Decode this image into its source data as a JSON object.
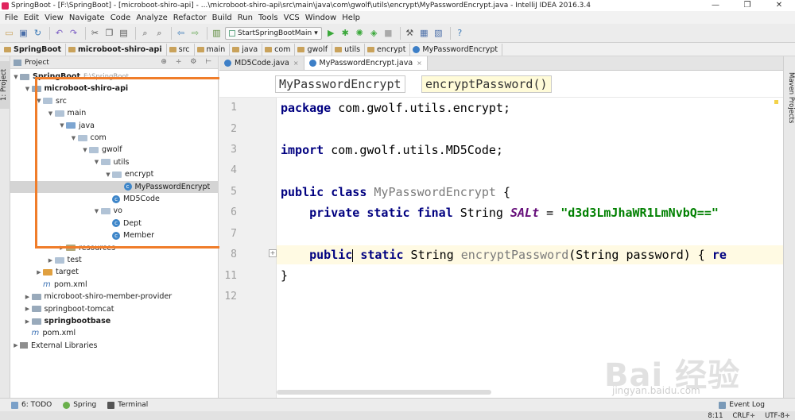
{
  "window": {
    "title": "SpringBoot - [F:\\SpringBoot] - [microboot-shiro-api] - ...\\microboot-shiro-api\\src\\main\\java\\com\\gwolf\\utils\\encrypt\\MyPasswordEncrypt.java - IntelliJ IDEA 2016.3.4",
    "controls": [
      "—",
      "❐",
      "✕"
    ]
  },
  "menu": [
    "File",
    "Edit",
    "View",
    "Navigate",
    "Code",
    "Analyze",
    "Refactor",
    "Build",
    "Run",
    "Tools",
    "VCS",
    "Window",
    "Help"
  ],
  "toolbar": {
    "run_config": "StartSpringBootMain",
    "run_config_arrow": "▾"
  },
  "breadcrumbs": [
    "SpringBoot",
    "microboot-shiro-api",
    "src",
    "main",
    "java",
    "com",
    "gwolf",
    "utils",
    "encrypt",
    "MyPasswordEncrypt"
  ],
  "left_strip": {
    "project_tab": "1: Project",
    "structure_tab": "2: Structure"
  },
  "project_panel": {
    "title": "Project",
    "tools": "⊕ ÷ ⚙ ⊢",
    "tree": [
      {
        "label": "SpringBoot",
        "hint": "F:\\SpringBoot",
        "depth": 0,
        "arrow": "▼",
        "kind": "mod",
        "bold": true
      },
      {
        "label": "microboot-shiro-api",
        "depth": 1,
        "arrow": "▼",
        "kind": "mod",
        "bold": true
      },
      {
        "label": "src",
        "depth": 2,
        "arrow": "▼",
        "kind": "folder"
      },
      {
        "label": "main",
        "depth": 3,
        "arrow": "▼",
        "kind": "folder"
      },
      {
        "label": "java",
        "depth": 4,
        "arrow": "▼",
        "kind": "src"
      },
      {
        "label": "com",
        "depth": 5,
        "arrow": "▼",
        "kind": "folder"
      },
      {
        "label": "gwolf",
        "depth": 6,
        "arrow": "▼",
        "kind": "folder"
      },
      {
        "label": "utils",
        "depth": 7,
        "arrow": "▼",
        "kind": "folder"
      },
      {
        "label": "encrypt",
        "depth": 8,
        "arrow": "▼",
        "kind": "folder"
      },
      {
        "label": "MyPasswordEncrypt",
        "depth": 9,
        "arrow": "",
        "kind": "class",
        "selected": true
      },
      {
        "label": "MD5Code",
        "depth": 8,
        "arrow": "",
        "kind": "class"
      },
      {
        "label": "vo",
        "depth": 7,
        "arrow": "▼",
        "kind": "folder"
      },
      {
        "label": "Dept",
        "depth": 8,
        "arrow": "",
        "kind": "class"
      },
      {
        "label": "Member",
        "depth": 8,
        "arrow": "",
        "kind": "class"
      },
      {
        "label": "resources",
        "depth": 4,
        "arrow": "▶",
        "kind": "res"
      },
      {
        "label": "test",
        "depth": 3,
        "arrow": "▶",
        "kind": "folder"
      },
      {
        "label": "target",
        "depth": 2,
        "arrow": "▶",
        "kind": "tgt"
      },
      {
        "label": "pom.xml",
        "depth": 2,
        "arrow": "",
        "kind": "pom"
      },
      {
        "label": "microboot-shiro-member-provider",
        "depth": 1,
        "arrow": "▶",
        "kind": "mod"
      },
      {
        "label": "springboot-tomcat",
        "depth": 1,
        "arrow": "▶",
        "kind": "mod"
      },
      {
        "label": "springbootbase",
        "depth": 1,
        "arrow": "▶",
        "kind": "mod",
        "bold": true
      },
      {
        "label": "pom.xml",
        "depth": 1,
        "arrow": "",
        "kind": "pom"
      },
      {
        "label": "External Libraries",
        "depth": 0,
        "arrow": "▶",
        "kind": "lib"
      }
    ]
  },
  "editor": {
    "tabs": [
      {
        "label": "MD5Code.java",
        "active": false
      },
      {
        "label": "MyPasswordEncrypt.java",
        "active": true
      }
    ],
    "tab_close": "×",
    "path": [
      "MyPasswordEncrypt",
      "encryptPassword()"
    ],
    "line_numbers": [
      "1",
      "2",
      "3",
      "4",
      "5",
      "6",
      "7",
      "8",
      "11",
      "12"
    ],
    "lines": {
      "l1": {
        "kw": "package",
        "rest": " com.gwolf.utils.encrypt;"
      },
      "l3": {
        "kw": "import",
        "rest": " com.gwolf.utils.MD5Code;"
      },
      "l5": {
        "kw": "public class",
        "name": " MyPasswordEncrypt",
        "rest": " {"
      },
      "l6": {
        "kw": "    private static final",
        "type": " String ",
        "field": "SALt",
        "eq": " = ",
        "str": "\"d3d3LmJhaWR1LmNvbQ==\""
      },
      "l8": {
        "kw1": "    public",
        "kw2": " static",
        "type": " String ",
        "name": "encryptPassword",
        "rest": "(String password) { ",
        "tail": "re"
      },
      "l11": {
        "rest": "}"
      }
    },
    "fold_icon": "+"
  },
  "right_strip": {
    "maven_tab": "Maven Projects"
  },
  "bottom_tools": [
    {
      "label": "6: TODO"
    },
    {
      "label": "Spring"
    },
    {
      "label": "Terminal"
    }
  ],
  "event_log": "Event Log",
  "status": {
    "position": "8:11",
    "line_sep": "CRLF÷",
    "encoding": "UTF-8÷"
  },
  "watermark": {
    "brand": "Bai 经验",
    "site": "jingyan.baidu.com"
  },
  "colors": {
    "highlight": "#f07d2a",
    "keyword": "#000080",
    "string": "#008000",
    "field": "#660e7a"
  }
}
